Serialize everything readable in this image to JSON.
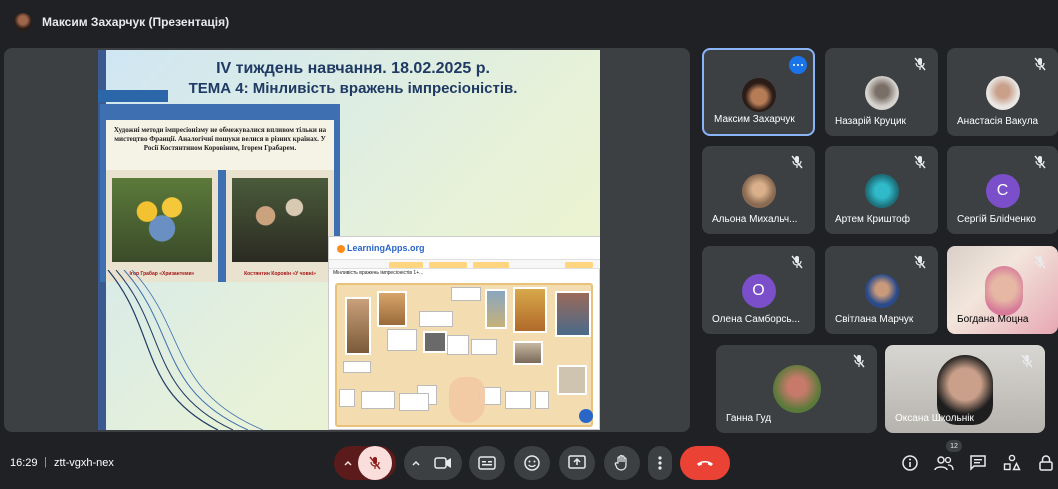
{
  "header": {
    "presenter_title": "Максим Захарчук (Презентація)"
  },
  "slide": {
    "title_line1": "IV тиждень навчання. 18.02.2025 р.",
    "title_line2": "ТЕМА 4: Мінливість вражень імпресіоністів.",
    "panel_text": "Художні методи імпресіонізму не обмежувалися впливом тільки на мистецтво Франції. Аналогічні пошуки велися в різних країнах. У Росії Костянтином Коровіним, Ігорем Грабарем.",
    "caption_left": "Ігор Грабар «Хризантеми»",
    "caption_right": "Костянтин Коровін «У човні»",
    "learningapps": {
      "logo": "LearningApps.org",
      "app_title": "Мінливість вражень імпресіоністів 1+..."
    }
  },
  "participants": [
    {
      "name": "Максим Захарчук",
      "active": true,
      "muted": false
    },
    {
      "name": "Назарій Круцик",
      "muted": true
    },
    {
      "name": "Анастасія Вакула",
      "muted": true
    },
    {
      "name": "Альона Михальч...",
      "muted": true
    },
    {
      "name": "Артем Криштоф",
      "muted": true
    },
    {
      "name": "Сергій Бліdченко",
      "muted": true,
      "initial": "С",
      "color": "#7b4fc9"
    },
    {
      "name": "Олена Самборсь...",
      "muted": true,
      "initial": "О",
      "color": "#7b4fc9"
    },
    {
      "name": "Світлана Марчук",
      "muted": true
    },
    {
      "name": "Богдана Моцна",
      "muted": true
    },
    {
      "name": "Ганна Гуд",
      "muted": true
    },
    {
      "name": "Оксана Школьнік",
      "muted": true
    }
  ],
  "footer": {
    "time": "16:29",
    "separator": "|",
    "meeting_code": "ztt-vgxh-nex",
    "people_count": "12"
  },
  "colors": {
    "end_call": "#ea4335",
    "mic_off_bg": "#f9dedc",
    "active_border": "#8ab4f8"
  }
}
